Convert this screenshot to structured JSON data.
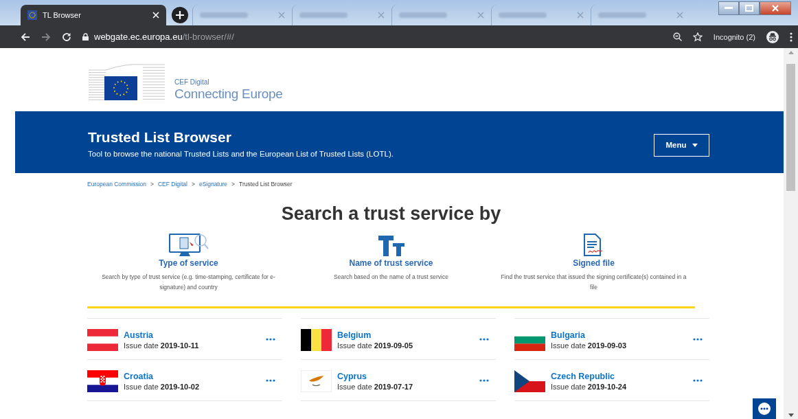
{
  "browser": {
    "tabs": [
      {
        "title": "TL Browser",
        "selected": true
      },
      {
        "selected": false
      },
      {
        "selected": false
      },
      {
        "selected": false
      },
      {
        "selected": false
      },
      {
        "selected": false
      }
    ],
    "url_host": "webgate.ec.europa.eu",
    "url_path": "/tl-browser/#/",
    "profile": "Incognito (2)"
  },
  "header": {
    "org": "CEF Digital",
    "tagline": "Connecting Europe"
  },
  "banner": {
    "title": "Trusted List Browser",
    "subtitle": "Tool to browse the national Trusted Lists and the European List of Trusted Lists (LOTL).",
    "menu": "Menu"
  },
  "breadcrumb": [
    {
      "label": "European Commission",
      "kind": "link"
    },
    {
      "label": ">",
      "kind": "separator"
    },
    {
      "label": "CEF Digital",
      "kind": "link"
    },
    {
      "label": ">",
      "kind": "separator"
    },
    {
      "label": "eSignature",
      "kind": "link"
    },
    {
      "label": ">",
      "kind": "separator"
    },
    {
      "label": "Trusted List Browser",
      "kind": "current"
    }
  ],
  "search": {
    "heading": "Search a trust service by",
    "options": [
      {
        "kind": "type",
        "title": "Type of service",
        "description": "Search by type of trust service (e.g. time-stamping, certificate for e-signature) and country"
      },
      {
        "kind": "name",
        "title": "Name of trust service",
        "description": "Search based on the name of a trust service"
      },
      {
        "kind": "file",
        "title": "Signed file",
        "description": "Find the trust service that issued the signing certificate(s) contained in a file"
      }
    ]
  },
  "countries": [
    {
      "kind": "at",
      "name": "Austria",
      "date_label": "Issue date",
      "date": "2019-10-11"
    },
    {
      "kind": "be",
      "name": "Belgium",
      "date_label": "Issue date",
      "date": "2019-09-05"
    },
    {
      "kind": "bg",
      "name": "Bulgaria",
      "date_label": "Issue date",
      "date": "2019-09-03"
    },
    {
      "kind": "hr",
      "name": "Croatia",
      "date_label": "Issue date",
      "date": "2019-10-02"
    },
    {
      "kind": "cy",
      "name": "Cyprus",
      "date_label": "Issue date",
      "date": "2019-07-17"
    },
    {
      "kind": "cz",
      "name": "Czech Republic",
      "date_label": "Issue date",
      "date": "2019-10-24"
    }
  ]
}
